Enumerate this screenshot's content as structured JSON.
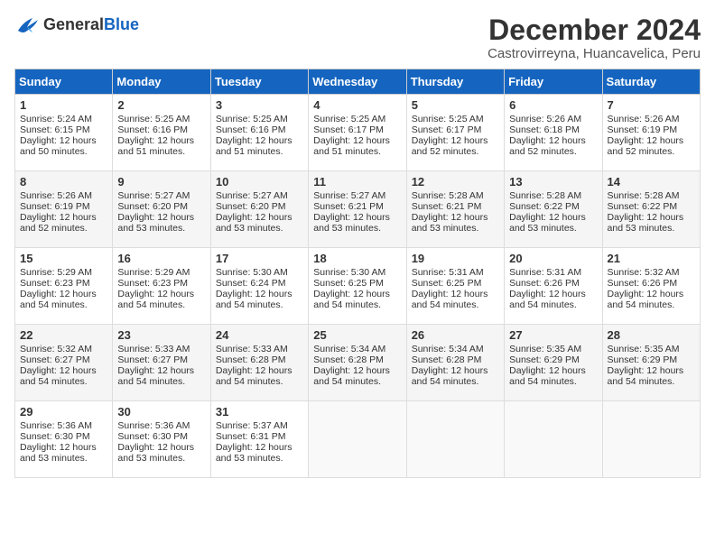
{
  "logo": {
    "general": "General",
    "blue": "Blue"
  },
  "title": "December 2024",
  "subtitle": "Castrovirreyna, Huancavelica, Peru",
  "calendar": {
    "headers": [
      "Sunday",
      "Monday",
      "Tuesday",
      "Wednesday",
      "Thursday",
      "Friday",
      "Saturday"
    ],
    "weeks": [
      [
        {
          "day": "1",
          "sunrise": "Sunrise: 5:24 AM",
          "sunset": "Sunset: 6:15 PM",
          "daylight": "Daylight: 12 hours and 50 minutes."
        },
        {
          "day": "2",
          "sunrise": "Sunrise: 5:25 AM",
          "sunset": "Sunset: 6:16 PM",
          "daylight": "Daylight: 12 hours and 51 minutes."
        },
        {
          "day": "3",
          "sunrise": "Sunrise: 5:25 AM",
          "sunset": "Sunset: 6:16 PM",
          "daylight": "Daylight: 12 hours and 51 minutes."
        },
        {
          "day": "4",
          "sunrise": "Sunrise: 5:25 AM",
          "sunset": "Sunset: 6:17 PM",
          "daylight": "Daylight: 12 hours and 51 minutes."
        },
        {
          "day": "5",
          "sunrise": "Sunrise: 5:25 AM",
          "sunset": "Sunset: 6:17 PM",
          "daylight": "Daylight: 12 hours and 52 minutes."
        },
        {
          "day": "6",
          "sunrise": "Sunrise: 5:26 AM",
          "sunset": "Sunset: 6:18 PM",
          "daylight": "Daylight: 12 hours and 52 minutes."
        },
        {
          "day": "7",
          "sunrise": "Sunrise: 5:26 AM",
          "sunset": "Sunset: 6:19 PM",
          "daylight": "Daylight: 12 hours and 52 minutes."
        }
      ],
      [
        {
          "day": "8",
          "sunrise": "Sunrise: 5:26 AM",
          "sunset": "Sunset: 6:19 PM",
          "daylight": "Daylight: 12 hours and 52 minutes."
        },
        {
          "day": "9",
          "sunrise": "Sunrise: 5:27 AM",
          "sunset": "Sunset: 6:20 PM",
          "daylight": "Daylight: 12 hours and 53 minutes."
        },
        {
          "day": "10",
          "sunrise": "Sunrise: 5:27 AM",
          "sunset": "Sunset: 6:20 PM",
          "daylight": "Daylight: 12 hours and 53 minutes."
        },
        {
          "day": "11",
          "sunrise": "Sunrise: 5:27 AM",
          "sunset": "Sunset: 6:21 PM",
          "daylight": "Daylight: 12 hours and 53 minutes."
        },
        {
          "day": "12",
          "sunrise": "Sunrise: 5:28 AM",
          "sunset": "Sunset: 6:21 PM",
          "daylight": "Daylight: 12 hours and 53 minutes."
        },
        {
          "day": "13",
          "sunrise": "Sunrise: 5:28 AM",
          "sunset": "Sunset: 6:22 PM",
          "daylight": "Daylight: 12 hours and 53 minutes."
        },
        {
          "day": "14",
          "sunrise": "Sunrise: 5:28 AM",
          "sunset": "Sunset: 6:22 PM",
          "daylight": "Daylight: 12 hours and 53 minutes."
        }
      ],
      [
        {
          "day": "15",
          "sunrise": "Sunrise: 5:29 AM",
          "sunset": "Sunset: 6:23 PM",
          "daylight": "Daylight: 12 hours and 54 minutes."
        },
        {
          "day": "16",
          "sunrise": "Sunrise: 5:29 AM",
          "sunset": "Sunset: 6:23 PM",
          "daylight": "Daylight: 12 hours and 54 minutes."
        },
        {
          "day": "17",
          "sunrise": "Sunrise: 5:30 AM",
          "sunset": "Sunset: 6:24 PM",
          "daylight": "Daylight: 12 hours and 54 minutes."
        },
        {
          "day": "18",
          "sunrise": "Sunrise: 5:30 AM",
          "sunset": "Sunset: 6:25 PM",
          "daylight": "Daylight: 12 hours and 54 minutes."
        },
        {
          "day": "19",
          "sunrise": "Sunrise: 5:31 AM",
          "sunset": "Sunset: 6:25 PM",
          "daylight": "Daylight: 12 hours and 54 minutes."
        },
        {
          "day": "20",
          "sunrise": "Sunrise: 5:31 AM",
          "sunset": "Sunset: 6:26 PM",
          "daylight": "Daylight: 12 hours and 54 minutes."
        },
        {
          "day": "21",
          "sunrise": "Sunrise: 5:32 AM",
          "sunset": "Sunset: 6:26 PM",
          "daylight": "Daylight: 12 hours and 54 minutes."
        }
      ],
      [
        {
          "day": "22",
          "sunrise": "Sunrise: 5:32 AM",
          "sunset": "Sunset: 6:27 PM",
          "daylight": "Daylight: 12 hours and 54 minutes."
        },
        {
          "day": "23",
          "sunrise": "Sunrise: 5:33 AM",
          "sunset": "Sunset: 6:27 PM",
          "daylight": "Daylight: 12 hours and 54 minutes."
        },
        {
          "day": "24",
          "sunrise": "Sunrise: 5:33 AM",
          "sunset": "Sunset: 6:28 PM",
          "daylight": "Daylight: 12 hours and 54 minutes."
        },
        {
          "day": "25",
          "sunrise": "Sunrise: 5:34 AM",
          "sunset": "Sunset: 6:28 PM",
          "daylight": "Daylight: 12 hours and 54 minutes."
        },
        {
          "day": "26",
          "sunrise": "Sunrise: 5:34 AM",
          "sunset": "Sunset: 6:28 PM",
          "daylight": "Daylight: 12 hours and 54 minutes."
        },
        {
          "day": "27",
          "sunrise": "Sunrise: 5:35 AM",
          "sunset": "Sunset: 6:29 PM",
          "daylight": "Daylight: 12 hours and 54 minutes."
        },
        {
          "day": "28",
          "sunrise": "Sunrise: 5:35 AM",
          "sunset": "Sunset: 6:29 PM",
          "daylight": "Daylight: 12 hours and 54 minutes."
        }
      ],
      [
        {
          "day": "29",
          "sunrise": "Sunrise: 5:36 AM",
          "sunset": "Sunset: 6:30 PM",
          "daylight": "Daylight: 12 hours and 53 minutes."
        },
        {
          "day": "30",
          "sunrise": "Sunrise: 5:36 AM",
          "sunset": "Sunset: 6:30 PM",
          "daylight": "Daylight: 12 hours and 53 minutes."
        },
        {
          "day": "31",
          "sunrise": "Sunrise: 5:37 AM",
          "sunset": "Sunset: 6:31 PM",
          "daylight": "Daylight: 12 hours and 53 minutes."
        },
        null,
        null,
        null,
        null
      ]
    ]
  }
}
